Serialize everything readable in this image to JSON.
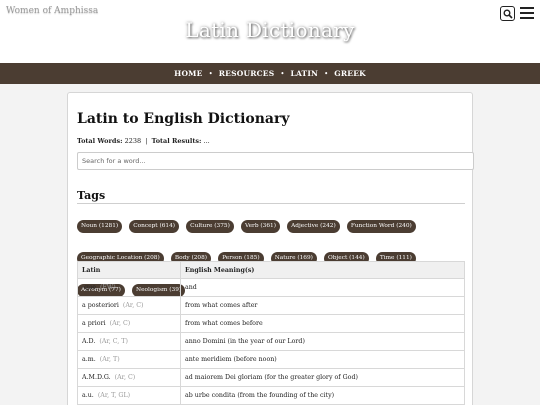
{
  "header": {
    "site_name": "Women of Amphissa",
    "site_title": "Latin Dictionary"
  },
  "nav": {
    "items": [
      "HOME",
      "RESOURCES",
      "LATIN",
      "GREEK"
    ]
  },
  "main": {
    "title": "Latin to English Dictionary",
    "total_words_label": "Total Words:",
    "total_words": "2238",
    "total_results_label": "Total Results:",
    "total_results": "...",
    "search_placeholder": "Search for a word...",
    "tags_title": "Tags",
    "tags": [
      "Noun (1281)",
      "Concept (614)",
      "Culture (375)",
      "Verb (361)",
      "Adjective (242)",
      "Function Word (240)",
      "Geographic Location (208)",
      "Body (208)",
      "Person (185)",
      "Nature (169)",
      "Object (144)",
      "Time (111)",
      "Acronym (77)",
      "Neologism (39)"
    ],
    "table": {
      "headers": [
        "Latin",
        "English Meaning(s)"
      ],
      "rows": [
        {
          "latin": "-que",
          "meta": "(FW)",
          "english": "and"
        },
        {
          "latin": "a posteriori",
          "meta": "(Ar, C)",
          "english": "from what comes after"
        },
        {
          "latin": "a priori",
          "meta": "(Ar, C)",
          "english": "from what comes before"
        },
        {
          "latin": "A.D.",
          "meta": "(Ar, C, T)",
          "english": "anno Domini (in the year of our Lord)"
        },
        {
          "latin": "a.m.",
          "meta": "(Ar, T)",
          "english": "ante meridiem (before noon)"
        },
        {
          "latin": "A.M.D.G.",
          "meta": "(Ar, C)",
          "english": "ad maiorem Dei gloriam (for the greater glory of God)"
        },
        {
          "latin": "a.u.",
          "meta": "(Ar, T, GL)",
          "english": "ab urbe condita (from the founding of the city)"
        }
      ]
    }
  }
}
